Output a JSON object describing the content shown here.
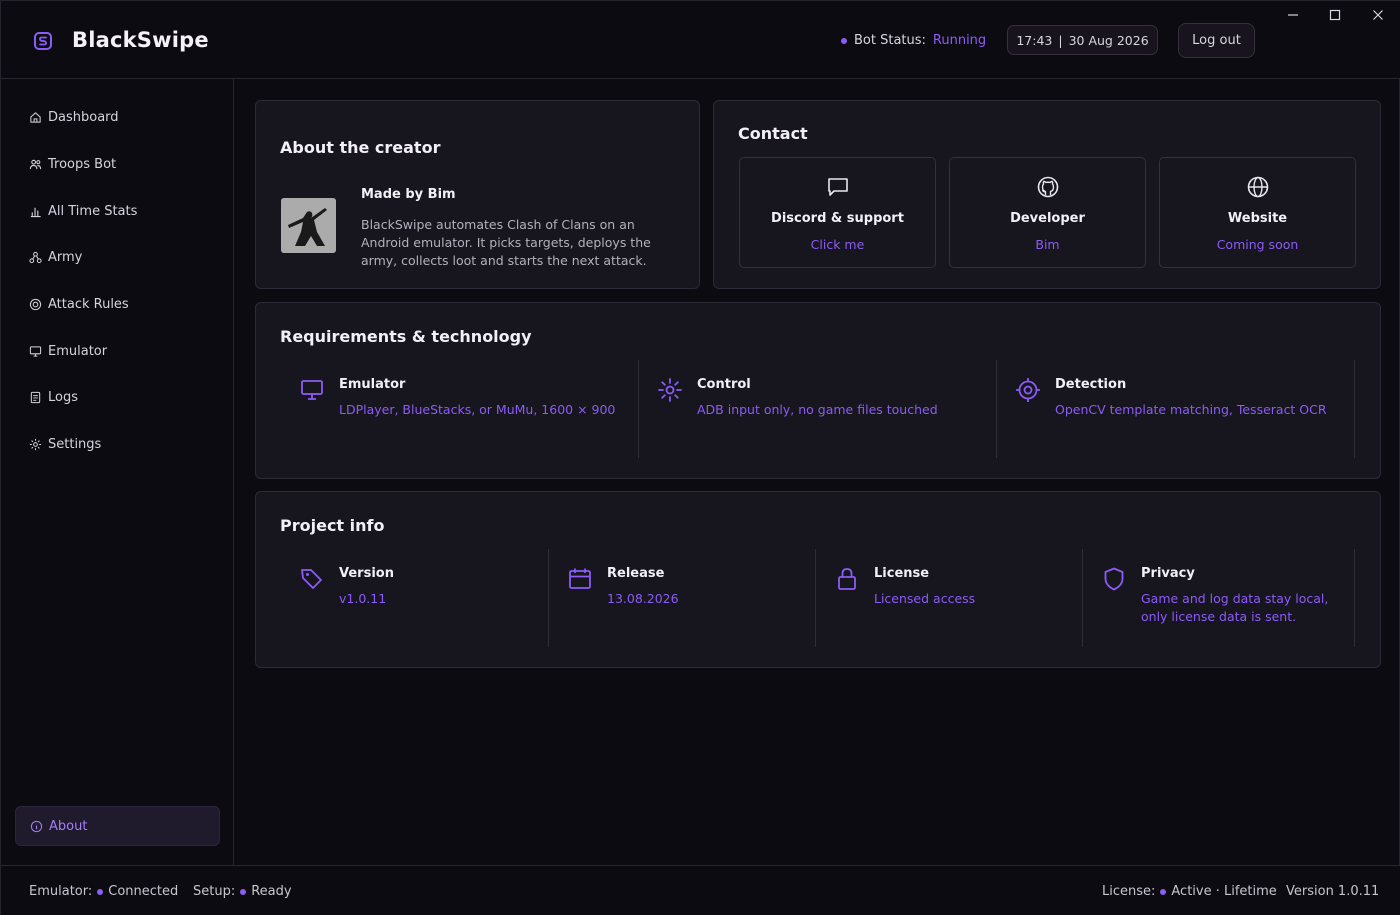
{
  "app": {
    "title": "BlackSwipe",
    "accent": "#8b5cf6"
  },
  "header": {
    "bot_status_label": "Bot Status:",
    "bot_status_value": "Running",
    "time": "17:43",
    "separator": "|",
    "date": "30 Aug 2026",
    "logout_label": "Log out"
  },
  "sidebar": {
    "items": [
      {
        "label": "Dashboard",
        "icon": "home-icon"
      },
      {
        "label": "Troops Bot",
        "icon": "users-icon"
      },
      {
        "label": "All Time Stats",
        "icon": "bar-chart-icon"
      },
      {
        "label": "Army",
        "icon": "network-icon"
      },
      {
        "label": "Attack Rules",
        "icon": "target-icon"
      },
      {
        "label": "Emulator",
        "icon": "monitor-icon"
      },
      {
        "label": "Logs",
        "icon": "file-icon"
      },
      {
        "label": "Settings",
        "icon": "gear-icon"
      }
    ],
    "active": {
      "label": "About",
      "icon": "info-icon"
    }
  },
  "about": {
    "title": "About the creator",
    "made_by": "Made by Bim",
    "description": "BlackSwipe automates Clash of Clans on an Android emulator. It picks targets, deploys the army, collects loot and starts the next attack."
  },
  "contact": {
    "title": "Contact",
    "tiles": [
      {
        "title": "Discord & support",
        "subtitle": "Click me",
        "icon": "chat-icon"
      },
      {
        "title": "Developer",
        "subtitle": "Bim",
        "icon": "github-icon"
      },
      {
        "title": "Website",
        "subtitle": "Coming soon",
        "icon": "globe-icon"
      }
    ]
  },
  "requirements": {
    "title": "Requirements & technology",
    "items": [
      {
        "title": "Emulator",
        "text": "LDPlayer, BlueStacks, or MuMu, 1600 × 900",
        "icon": "monitor-icon"
      },
      {
        "title": "Control",
        "text": "ADB input only, no game files touched",
        "icon": "sun-icon"
      },
      {
        "title": "Detection",
        "text": "OpenCV template matching, Tesseract OCR",
        "icon": "crosshair-icon"
      }
    ]
  },
  "project": {
    "title": "Project info",
    "items": [
      {
        "title": "Version",
        "text": "v1.0.11",
        "icon": "tag-icon"
      },
      {
        "title": "Release",
        "text": "13.08.2026",
        "icon": "calendar-icon"
      },
      {
        "title": "License",
        "text": "Licensed access",
        "icon": "lock-icon"
      },
      {
        "title": "Privacy",
        "text": "Game and log data stay local, only license data is sent.",
        "icon": "shield-icon"
      }
    ]
  },
  "statusbar": {
    "emulator_label": "Emulator:",
    "emulator_value": "Connected",
    "setup_label": "Setup:",
    "setup_value": "Ready",
    "license_label": "License:",
    "license_value": "Active · Lifetime",
    "version": "Version 1.0.11"
  }
}
